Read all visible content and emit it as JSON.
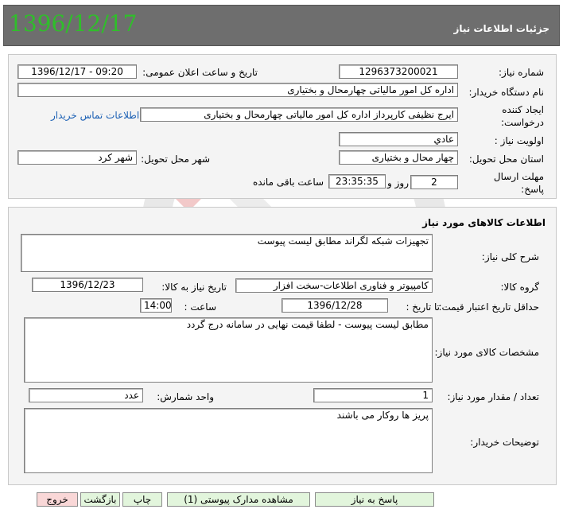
{
  "header": {
    "title": "جزئیات اطلاعات نیاز",
    "date_stamp": "1396/12/17"
  },
  "details": {
    "need_number_label": "شماره نیاز:",
    "need_number": "1296373200021",
    "announce_datetime_label": "تاریخ و ساعت اعلان عمومی:",
    "announce_datetime": "1396/12/17 - 09:20",
    "buyer_org_label": "نام دستگاه خریدار:",
    "buyer_org": "اداره کل امور مالیاتی چهارمحال و بختیاری",
    "requester_label": "ایجاد کننده درخواست:",
    "requester": "ایرج نظیفی کارپرداز اداره کل امور مالیاتی چهارمحال و بختیاری",
    "buyer_contact_link": "اطلاعات تماس خریدار",
    "priority_label": "اولویت نیاز :",
    "priority": "عادي",
    "delivery_province_label": "استان محل تحویل:",
    "delivery_province": "چهار محال و بختیاری",
    "delivery_city_label": "شهر محل تحویل:",
    "delivery_city": "شهر کرد",
    "response_deadline_label": "مهلت ارسال پاسخ:",
    "days_value": "2",
    "days_word": "روز و",
    "time_remaining": "23:35:35",
    "remaining_word": "ساعت باقی مانده"
  },
  "goods": {
    "section_title": "اطلاعات کالاهای مورد نیاز",
    "summary_label": "شرح کلی نیاز:",
    "summary": "تجهیزات شبکه لگراند مطابق لیست پیوست",
    "group_label": "گروه کالا:",
    "group": "کامپیوتر و فناوری اطلاعات-سخت افزار",
    "need_date_label": "تاریخ نیاز به کالا:",
    "need_date": "1396/12/23",
    "min_validity_label": "حداقل تاریخ اعتبار قیمت:",
    "until_date_label": "تا تاریخ :",
    "until_date": "1396/12/28",
    "time_label": "ساعت :",
    "time_value": "14:00",
    "specs_label": "مشخصات کالای مورد نیاز:",
    "specs": "مطابق لیست پیوست - لطفا قیمت نهایی در سامانه درج گردد",
    "quantity_label": "تعداد / مقدار مورد نیاز:",
    "quantity": "1",
    "unit_label": "واحد شمارش:",
    "unit": "عدد",
    "buyer_notes_label": "توضیحات خریدار:",
    "buyer_notes": "پریز ها روکار می باشند"
  },
  "buttons": {
    "respond": "پاسخ به نیاز",
    "view_attachments": "مشاهده مدارک پیوستی (1)",
    "print": "چاپ",
    "back": "بازگشت",
    "exit": "خروج"
  },
  "colors": {
    "header_bg": "#6e6e6e",
    "stamp_green": "#2fbf2a",
    "panel_bg": "#f4f4f4",
    "button_green": "#e2f5dc",
    "exit_pink": "#f9d7d7",
    "link_blue": "#1a5fb4"
  }
}
